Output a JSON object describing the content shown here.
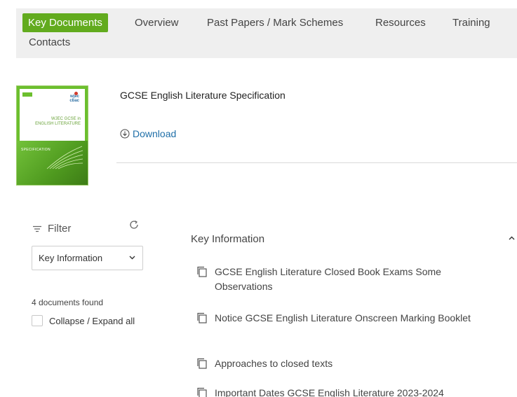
{
  "tabs": {
    "active": "Key Documents",
    "overview": "Overview",
    "past_papers": "Past Papers / Mark Schemes",
    "resources": "Resources",
    "training": "Training",
    "contacts": "Contacts"
  },
  "document": {
    "cover": {
      "tag": "GCSE",
      "logo_line1": "wjec",
      "logo_line2": "cbac",
      "subtitle1": "WJEC GCSE in",
      "subtitle2": "ENGLISH LITERATURE",
      "spec_label": "SPECIFICATION"
    },
    "title": "GCSE English Literature Specification",
    "download_label": "Download"
  },
  "filter": {
    "label": "Filter",
    "selected": "Key Information",
    "count_text": "4 documents found",
    "collapse_label": "Collapse / Expand all"
  },
  "section": {
    "title": "Key Information",
    "items": [
      {
        "label": "GCSE English Literature Closed Book Exams Some Observations"
      },
      {
        "label": "Notice GCSE English Literature Onscreen Marking Booklet"
      },
      {
        "label": "Approaches to closed texts"
      },
      {
        "label": "Important Dates GCSE English Literature 2023-2024"
      }
    ]
  },
  "colors": {
    "accent": "#62ab1e",
    "link": "#1f6fa8",
    "tabbar_bg": "#efefef"
  }
}
